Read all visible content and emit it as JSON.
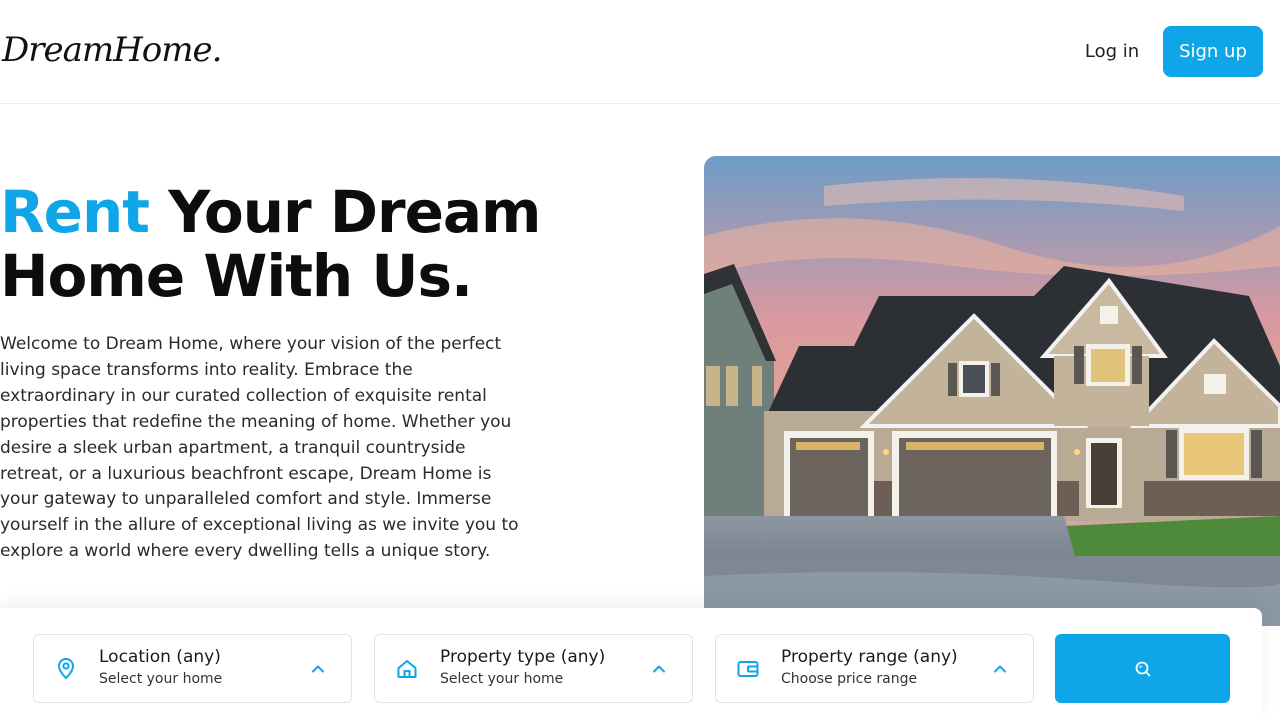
{
  "header": {
    "logo": "DreamHome.",
    "login_label": "Log in",
    "signup_label": "Sign up"
  },
  "hero": {
    "title_accent": "Rent",
    "title_rest_line1": " Your Dream",
    "title_line2": "Home With Us.",
    "description": "Welcome to Dream Home, where your vision of the perfect living space transforms into reality. Embrace the extraordinary in our curated collection of exquisite rental properties that redefine the meaning of home. Whether you desire a sleek urban apartment, a tranquil countryside retreat, or a luxurious beachfront escape, Dream Home is your gateway to unparalleled comfort and style. Immerse yourself in the allure of exceptional living as we invite you to explore a world where every dwelling tells a unique story."
  },
  "search": {
    "fields": [
      {
        "label": "Location (any)",
        "sub": "Select your home",
        "icon": "map-pin-icon"
      },
      {
        "label": "Property type (any)",
        "sub": "Select your home",
        "icon": "home-icon"
      },
      {
        "label": "Property range (any)",
        "sub": "Choose price range",
        "icon": "wallet-icon"
      }
    ],
    "button_icon": "search-icon"
  },
  "colors": {
    "accent": "#0ea5e9",
    "text": "#0d0d0d"
  }
}
